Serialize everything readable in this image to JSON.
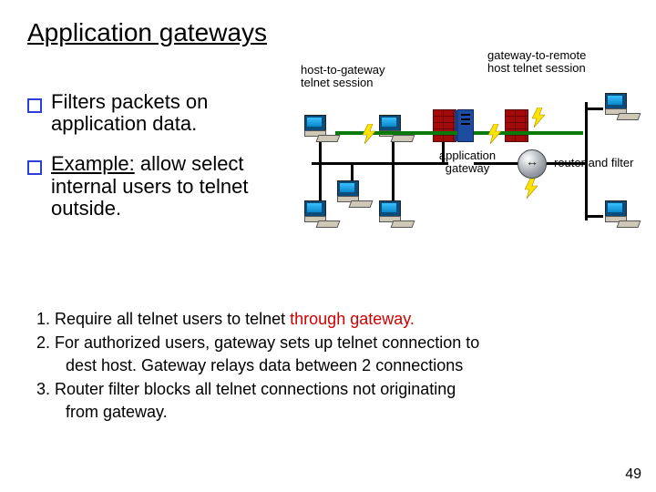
{
  "title": "Application gateways",
  "bullets": [
    {
      "pre": "",
      "ul": "",
      "post": "Filters packets on application data."
    },
    {
      "pre": "",
      "ul": "Example:",
      "post": " allow select internal users to telnet outside."
    }
  ],
  "numbered": {
    "l1_a": "1. Require all telnet users to telnet ",
    "l1_red": "through gateway.",
    "l2": "2. For authorized users, gateway sets up telnet connection to",
    "l2b": "dest host. Gateway relays data between 2 connections",
    "l3": "3. Router filter blocks all telnet connections not originating",
    "l3b": "from gateway."
  },
  "diagram": {
    "label_hg": "host-to-gateway\ntelnet session",
    "label_gr": "gateway-to-remote\nhost telnet session",
    "label_app": "application\ngateway",
    "label_rf": "router and filter"
  },
  "page": "49"
}
